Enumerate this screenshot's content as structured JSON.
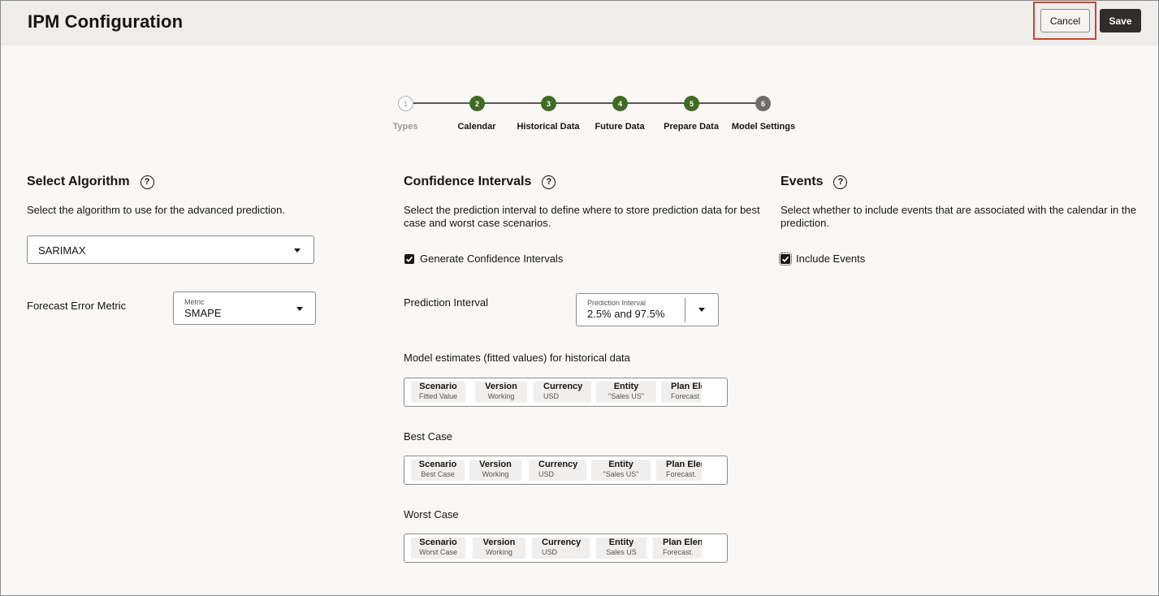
{
  "header": {
    "title": "IPM Configuration",
    "cancel_label": "Cancel",
    "save_label": "Save"
  },
  "train": {
    "steps": [
      {
        "number": "1",
        "label": "Types",
        "state": "visited"
      },
      {
        "number": "2",
        "label": "Calendar",
        "state": "done"
      },
      {
        "number": "3",
        "label": "Historical Data",
        "state": "done"
      },
      {
        "number": "4",
        "label": "Future Data",
        "state": "done"
      },
      {
        "number": "5",
        "label": "Prepare Data",
        "state": "done"
      },
      {
        "number": "6",
        "label": "Model Settings",
        "state": "current"
      }
    ]
  },
  "algorithm": {
    "title": "Select Algorithm",
    "description": "Select the algorithm to use for the advanced prediction.",
    "selected": "SARIMAX",
    "metric_label": "Forecast Error Metric",
    "metric_float_label": "Metric",
    "metric_value": "SMAPE"
  },
  "confidence": {
    "title": "Confidence Intervals",
    "description_line1": "Select the prediction interval to define where to store prediction data for best",
    "description_line2": "case and worst case scenarios.",
    "generate_label": "Generate Confidence Intervals",
    "generate_checked": true,
    "interval_label": "Prediction Interval",
    "interval_float_label": "Prediction Interval",
    "interval_value": "2.5% and 97.5%",
    "fitted_label": "Model estimates (fitted values) for historical data",
    "fitted_pov": [
      {
        "dim": "Scenario",
        "member": "Fitted Value"
      },
      {
        "dim": "Version",
        "member": "Working"
      },
      {
        "dim": "Currency",
        "member": "USD"
      },
      {
        "dim": "Entity",
        "member": "\"Sales US\""
      },
      {
        "dim": "Plan Ele",
        "member": "Forecast"
      }
    ],
    "best_label": "Best Case",
    "best_pov": [
      {
        "dim": "Scenario",
        "member": "Best Case"
      },
      {
        "dim": "Version",
        "member": "Working"
      },
      {
        "dim": "Currency",
        "member": "USD"
      },
      {
        "dim": "Entity",
        "member": "\"Sales US\""
      },
      {
        "dim": "Plan Elen",
        "member": "Forecast."
      }
    ],
    "worst_label": "Worst Case",
    "worst_pov": [
      {
        "dim": "Scenario",
        "member": "Worst Case"
      },
      {
        "dim": "Version",
        "member": "Working"
      },
      {
        "dim": "Currency",
        "member": "USD"
      },
      {
        "dim": "Entity",
        "member": "Sales US"
      },
      {
        "dim": "Plan Elen",
        "member": "Forecast."
      }
    ]
  },
  "events": {
    "title": "Events",
    "description_line1": "Select whether to include events that are associated with the calendar in the",
    "description_line2": "prediction.",
    "include_label": "Include Events",
    "include_checked": true
  },
  "icons": {
    "help": "question-circle-icon",
    "dropdown": "caret-down-icon",
    "check": "checkmark-icon"
  }
}
